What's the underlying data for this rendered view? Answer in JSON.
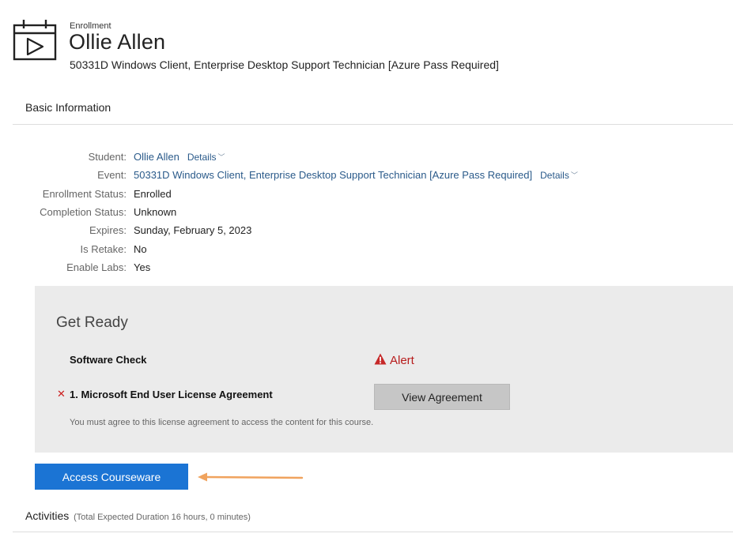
{
  "header": {
    "kicker": "Enrollment",
    "name": "Ollie Allen",
    "course": "50331D Windows Client, Enterprise Desktop Support Technician [Azure Pass Required]",
    "icon": "calendar-play-icon"
  },
  "basic_info": {
    "title": "Basic Information",
    "rows": [
      {
        "label": "Student:",
        "value": "Ollie Allen",
        "link": true,
        "details": "Details"
      },
      {
        "label": "Event:",
        "value": "50331D Windows Client, Enterprise Desktop Support Technician [Azure Pass Required]",
        "link": true,
        "details": "Details"
      },
      {
        "label": "Enrollment Status:",
        "value": "Enrolled"
      },
      {
        "label": "Completion Status:",
        "value": "Unknown"
      },
      {
        "label": "Expires:",
        "value": "Sunday, February 5, 2023"
      },
      {
        "label": "Is Retake:",
        "value": "No"
      },
      {
        "label": "Enable Labs:",
        "value": "Yes"
      }
    ]
  },
  "get_ready": {
    "title": "Get Ready",
    "software_check": "Software Check",
    "alert_label": "Alert",
    "eula_mark": "✕",
    "eula_title": "1. Microsoft End User License Agreement",
    "view_button": "View Agreement",
    "eula_note": "You must agree to this license agreement to access the content for this course."
  },
  "access_button": "Access Courseware",
  "activities": {
    "title": "Activities",
    "note": "(Total Expected Duration 16 hours, 0 minutes)"
  },
  "colors": {
    "accent": "#1b74d4",
    "link": "#2a5a8a",
    "alert": "#b71c1c",
    "arrow": "#f0a35e",
    "panel_bg": "#ebebeb"
  }
}
